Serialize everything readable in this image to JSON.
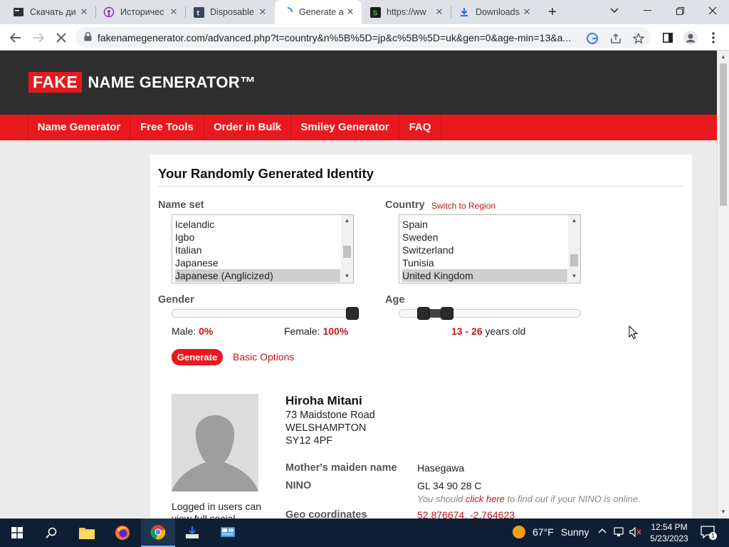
{
  "tabs": [
    {
      "title": "Скачать ди",
      "icon": "terminal-icon"
    },
    {
      "title": "Историчес",
      "icon": "podcast-icon"
    },
    {
      "title": "Disposable",
      "icon": "tumblr-icon"
    },
    {
      "title": "Generate a",
      "icon": "loading-spinner-icon"
    },
    {
      "title": "https://ww",
      "icon": "sitepoint-icon"
    },
    {
      "title": "Downloads",
      "icon": "download-icon"
    }
  ],
  "address_bar": {
    "url": "fakenamegenerator.com/advanced.php?t=country&n%5B%5D=jp&c%5B%5D=uk&gen=0&age-min=13&a..."
  },
  "site": {
    "logo_fake": "FAKE",
    "logo_rest": "NAME GENERATOR™",
    "nav": [
      "Name Generator",
      "Free Tools",
      "Order in Bulk",
      "Smiley Generator",
      "FAQ"
    ]
  },
  "card": {
    "title": "Your Randomly Generated Identity",
    "name_set_label": "Name set",
    "name_set_options": [
      "Icelandic",
      "Igbo",
      "Italian",
      "Japanese",
      "Japanese (Anglicized)"
    ],
    "name_set_selected": "Japanese (Anglicized)",
    "country_label": "Country",
    "switch_to_region": "Switch to Region",
    "country_options": [
      "Spain",
      "Sweden",
      "Switzerland",
      "Tunisia",
      "United Kingdom"
    ],
    "country_selected": "United Kingdom",
    "gender_label": "Gender",
    "male_label": "Male:",
    "male_value": "0%",
    "female_label": "Female:",
    "female_value": "100%",
    "female_fraction": 1.0,
    "age_label": "Age",
    "age_min": "13",
    "age_sep": "-",
    "age_max": "26",
    "age_suffix": "years old",
    "generate_button": "Generate",
    "basic_options_link": "Basic Options"
  },
  "identity": {
    "name": "Hiroha Mitani",
    "address_lines": [
      "73 Maidstone Road",
      "WELSHAMPTON",
      "SY12 4PF"
    ],
    "avatar_caption": "Logged in users can view full social",
    "mothers_maiden_name_label": "Mother's maiden name",
    "mothers_maiden_name": "Hasegawa",
    "nino_label": "NINO",
    "nino": "GL 34 90 28 C",
    "nino_note_pre": "You should",
    "nino_note_link": "click here",
    "nino_note_post": "to find out if your NINO is online.",
    "geo_label": "Geo coordinates",
    "geo_value": "52.876674, -2.764623"
  },
  "taskbar": {
    "weather_temp": "67°F",
    "weather_text": "Sunny",
    "time": "12:54 PM",
    "date": "5/23/2023",
    "notifications": "1"
  },
  "colors": {
    "brand_red": "#e8191e",
    "header_dark": "#2f2f2f",
    "link_red": "#c0161b"
  }
}
